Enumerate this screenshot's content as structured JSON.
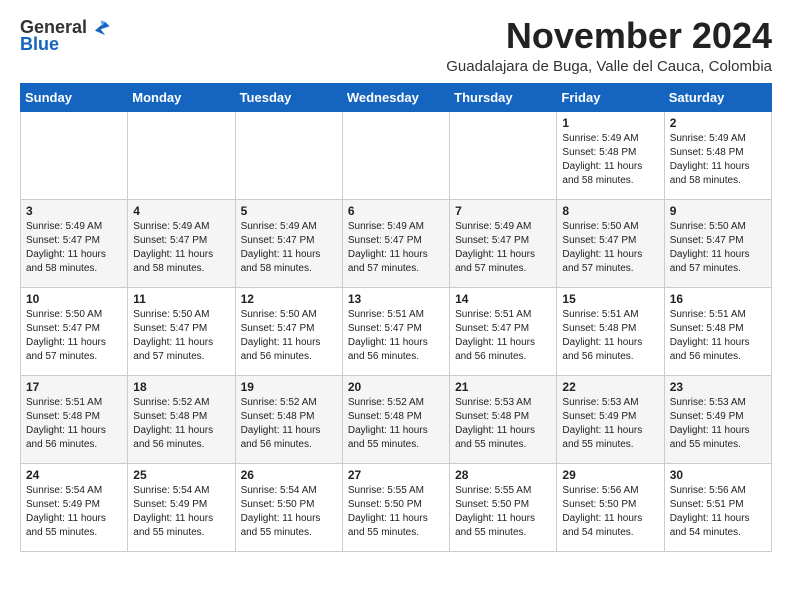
{
  "logo": {
    "general": "General",
    "blue": "Blue"
  },
  "header": {
    "title": "November 2024",
    "subtitle": "Guadalajara de Buga, Valle del Cauca, Colombia"
  },
  "weekdays": [
    "Sunday",
    "Monday",
    "Tuesday",
    "Wednesday",
    "Thursday",
    "Friday",
    "Saturday"
  ],
  "weeks": [
    [
      {
        "day": "",
        "text": ""
      },
      {
        "day": "",
        "text": ""
      },
      {
        "day": "",
        "text": ""
      },
      {
        "day": "",
        "text": ""
      },
      {
        "day": "",
        "text": ""
      },
      {
        "day": "1",
        "text": "Sunrise: 5:49 AM\nSunset: 5:48 PM\nDaylight: 11 hours and 58 minutes."
      },
      {
        "day": "2",
        "text": "Sunrise: 5:49 AM\nSunset: 5:48 PM\nDaylight: 11 hours and 58 minutes."
      }
    ],
    [
      {
        "day": "3",
        "text": "Sunrise: 5:49 AM\nSunset: 5:47 PM\nDaylight: 11 hours and 58 minutes."
      },
      {
        "day": "4",
        "text": "Sunrise: 5:49 AM\nSunset: 5:47 PM\nDaylight: 11 hours and 58 minutes."
      },
      {
        "day": "5",
        "text": "Sunrise: 5:49 AM\nSunset: 5:47 PM\nDaylight: 11 hours and 58 minutes."
      },
      {
        "day": "6",
        "text": "Sunrise: 5:49 AM\nSunset: 5:47 PM\nDaylight: 11 hours and 57 minutes."
      },
      {
        "day": "7",
        "text": "Sunrise: 5:49 AM\nSunset: 5:47 PM\nDaylight: 11 hours and 57 minutes."
      },
      {
        "day": "8",
        "text": "Sunrise: 5:50 AM\nSunset: 5:47 PM\nDaylight: 11 hours and 57 minutes."
      },
      {
        "day": "9",
        "text": "Sunrise: 5:50 AM\nSunset: 5:47 PM\nDaylight: 11 hours and 57 minutes."
      }
    ],
    [
      {
        "day": "10",
        "text": "Sunrise: 5:50 AM\nSunset: 5:47 PM\nDaylight: 11 hours and 57 minutes."
      },
      {
        "day": "11",
        "text": "Sunrise: 5:50 AM\nSunset: 5:47 PM\nDaylight: 11 hours and 57 minutes."
      },
      {
        "day": "12",
        "text": "Sunrise: 5:50 AM\nSunset: 5:47 PM\nDaylight: 11 hours and 56 minutes."
      },
      {
        "day": "13",
        "text": "Sunrise: 5:51 AM\nSunset: 5:47 PM\nDaylight: 11 hours and 56 minutes."
      },
      {
        "day": "14",
        "text": "Sunrise: 5:51 AM\nSunset: 5:47 PM\nDaylight: 11 hours and 56 minutes."
      },
      {
        "day": "15",
        "text": "Sunrise: 5:51 AM\nSunset: 5:48 PM\nDaylight: 11 hours and 56 minutes."
      },
      {
        "day": "16",
        "text": "Sunrise: 5:51 AM\nSunset: 5:48 PM\nDaylight: 11 hours and 56 minutes."
      }
    ],
    [
      {
        "day": "17",
        "text": "Sunrise: 5:51 AM\nSunset: 5:48 PM\nDaylight: 11 hours and 56 minutes."
      },
      {
        "day": "18",
        "text": "Sunrise: 5:52 AM\nSunset: 5:48 PM\nDaylight: 11 hours and 56 minutes."
      },
      {
        "day": "19",
        "text": "Sunrise: 5:52 AM\nSunset: 5:48 PM\nDaylight: 11 hours and 56 minutes."
      },
      {
        "day": "20",
        "text": "Sunrise: 5:52 AM\nSunset: 5:48 PM\nDaylight: 11 hours and 55 minutes."
      },
      {
        "day": "21",
        "text": "Sunrise: 5:53 AM\nSunset: 5:48 PM\nDaylight: 11 hours and 55 minutes."
      },
      {
        "day": "22",
        "text": "Sunrise: 5:53 AM\nSunset: 5:49 PM\nDaylight: 11 hours and 55 minutes."
      },
      {
        "day": "23",
        "text": "Sunrise: 5:53 AM\nSunset: 5:49 PM\nDaylight: 11 hours and 55 minutes."
      }
    ],
    [
      {
        "day": "24",
        "text": "Sunrise: 5:54 AM\nSunset: 5:49 PM\nDaylight: 11 hours and 55 minutes."
      },
      {
        "day": "25",
        "text": "Sunrise: 5:54 AM\nSunset: 5:49 PM\nDaylight: 11 hours and 55 minutes."
      },
      {
        "day": "26",
        "text": "Sunrise: 5:54 AM\nSunset: 5:50 PM\nDaylight: 11 hours and 55 minutes."
      },
      {
        "day": "27",
        "text": "Sunrise: 5:55 AM\nSunset: 5:50 PM\nDaylight: 11 hours and 55 minutes."
      },
      {
        "day": "28",
        "text": "Sunrise: 5:55 AM\nSunset: 5:50 PM\nDaylight: 11 hours and 55 minutes."
      },
      {
        "day": "29",
        "text": "Sunrise: 5:56 AM\nSunset: 5:50 PM\nDaylight: 11 hours and 54 minutes."
      },
      {
        "day": "30",
        "text": "Sunrise: 5:56 AM\nSunset: 5:51 PM\nDaylight: 11 hours and 54 minutes."
      }
    ]
  ]
}
